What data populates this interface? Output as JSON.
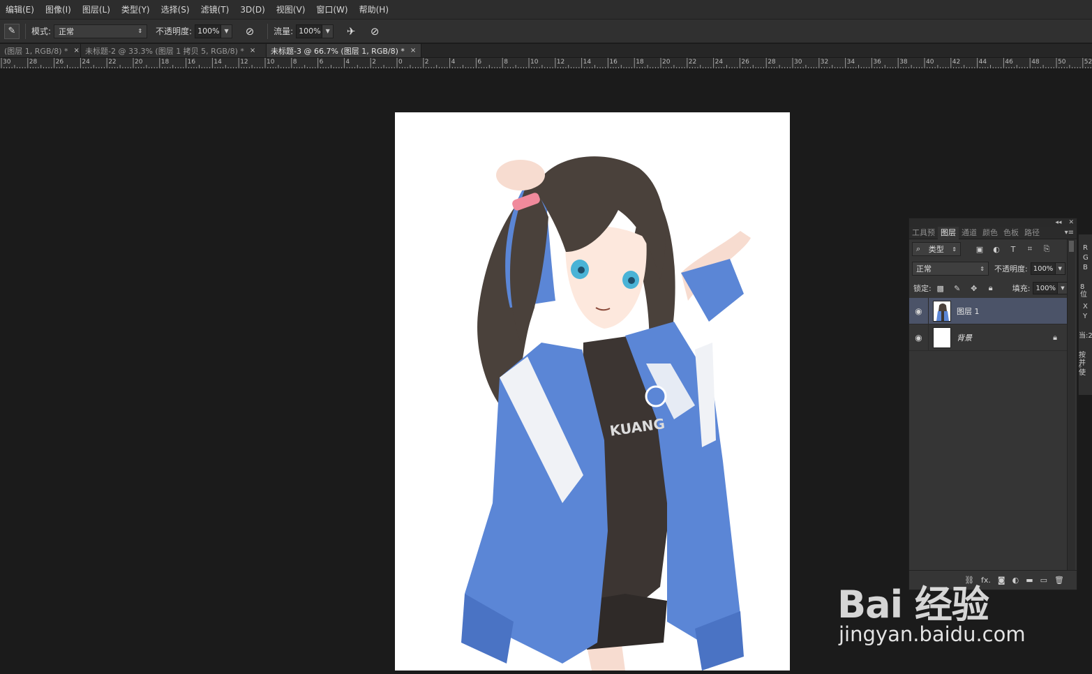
{
  "menu": [
    "编辑(E)",
    "图像(I)",
    "图层(L)",
    "类型(Y)",
    "选择(S)",
    "滤镜(T)",
    "3D(D)",
    "视图(V)",
    "窗口(W)",
    "帮助(H)"
  ],
  "options": {
    "mode_label": "模式:",
    "mode_value": "正常",
    "opacity_label": "不透明度:",
    "opacity_value": "100%",
    "flow_label": "流量:",
    "flow_value": "100%"
  },
  "tabs": [
    {
      "label": "(图层 1, RGB/8) *",
      "close": "×"
    },
    {
      "label": "未标题-2 @ 33.3% (图层 1 拷贝 5, RGB/8) *",
      "close": "×"
    },
    {
      "label": "未标题-3 @ 66.7% (图层 1, RGB/8) *",
      "close": "×"
    }
  ],
  "ruler_labels": [
    "30",
    "28",
    "26",
    "24",
    "22",
    "20",
    "18",
    "16",
    "14",
    "12",
    "10",
    "8",
    "6",
    "4",
    "2",
    "0",
    "2",
    "4",
    "6",
    "8",
    "10",
    "12",
    "14",
    "16",
    "18",
    "20",
    "22",
    "24",
    "26",
    "28",
    "30",
    "32",
    "34",
    "36",
    "38",
    "40",
    "42",
    "44",
    "46",
    "48",
    "50",
    "52"
  ],
  "canvas_text": "KUANG",
  "layers_panel": {
    "tabs": [
      "工具预",
      "图层",
      "通道",
      "颜色",
      "色板",
      "路径"
    ],
    "kind_filter": "类型",
    "blend_mode": "正常",
    "opacity_label": "不透明度:",
    "opacity_value": "100%",
    "lock_label": "锁定:",
    "fill_label": "填充:",
    "fill_value": "100%",
    "layers": [
      {
        "name": "图层 1",
        "selected": true
      },
      {
        "name": "背景",
        "locked": true
      }
    ],
    "footer_fx": "fx."
  },
  "side_strip": [
    "R",
    "G",
    "B",
    "8 位",
    "X",
    "Y",
    "当:2",
    "按并",
    "。使"
  ],
  "watermark": {
    "logo": "Bai 经验",
    "url": "jingyan.baidu.com"
  },
  "colors": {
    "jacket_blue": "#5b86d6",
    "selected_layer": "#4b5368",
    "hair": "#4a413b"
  }
}
